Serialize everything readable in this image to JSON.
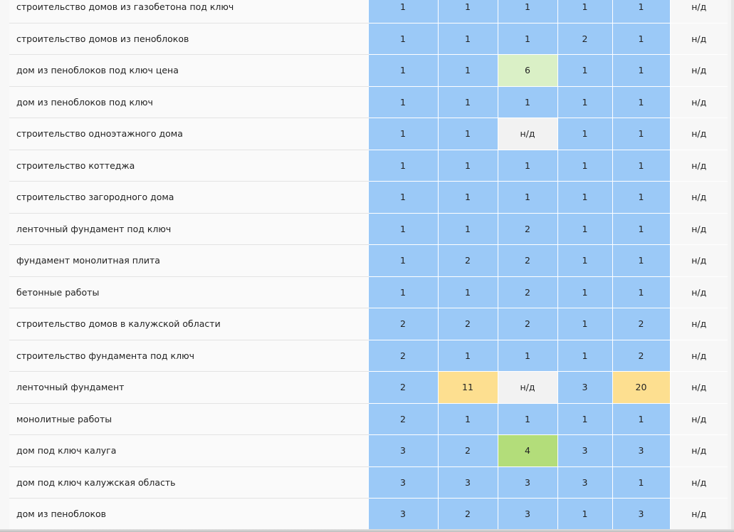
{
  "rows": [
    {
      "keyword": "строительство домов из газобетона под ключ",
      "values": [
        "1",
        "1",
        "1",
        "1",
        "1",
        "н/д"
      ],
      "colors": [
        "blue",
        "blue",
        "blue",
        "blue",
        "blue",
        "na"
      ]
    },
    {
      "keyword": "строительство домов из пеноблоков",
      "values": [
        "1",
        "1",
        "1",
        "2",
        "1",
        "н/д"
      ],
      "colors": [
        "blue",
        "blue",
        "blue",
        "blue",
        "blue",
        "na"
      ]
    },
    {
      "keyword": "дом из пеноблоков под ключ цена",
      "values": [
        "1",
        "1",
        "6",
        "1",
        "1",
        "н/д"
      ],
      "colors": [
        "blue",
        "blue",
        "lgreen",
        "blue",
        "blue",
        "na"
      ]
    },
    {
      "keyword": "дом из пеноблоков под ключ",
      "values": [
        "1",
        "1",
        "1",
        "1",
        "1",
        "н/д"
      ],
      "colors": [
        "blue",
        "blue",
        "blue",
        "blue",
        "blue",
        "na"
      ]
    },
    {
      "keyword": "строительство одноэтажного дома",
      "values": [
        "1",
        "1",
        "н/д",
        "1",
        "1",
        "н/д"
      ],
      "colors": [
        "blue",
        "blue",
        "na",
        "blue",
        "blue",
        "na"
      ]
    },
    {
      "keyword": "строительство коттеджа",
      "values": [
        "1",
        "1",
        "1",
        "1",
        "1",
        "н/д"
      ],
      "colors": [
        "blue",
        "blue",
        "blue",
        "blue",
        "blue",
        "na"
      ]
    },
    {
      "keyword": "строительство загородного дома",
      "values": [
        "1",
        "1",
        "1",
        "1",
        "1",
        "н/д"
      ],
      "colors": [
        "blue",
        "blue",
        "blue",
        "blue",
        "blue",
        "na"
      ]
    },
    {
      "keyword": "ленточный фундамент под ключ",
      "values": [
        "1",
        "1",
        "2",
        "1",
        "1",
        "н/д"
      ],
      "colors": [
        "blue",
        "blue",
        "blue",
        "blue",
        "blue",
        "na"
      ]
    },
    {
      "keyword": "фундамент монолитная плита",
      "values": [
        "1",
        "2",
        "2",
        "1",
        "1",
        "н/д"
      ],
      "colors": [
        "blue",
        "blue",
        "blue",
        "blue",
        "blue",
        "na"
      ]
    },
    {
      "keyword": "бетонные работы",
      "values": [
        "1",
        "1",
        "2",
        "1",
        "1",
        "н/д"
      ],
      "colors": [
        "blue",
        "blue",
        "blue",
        "blue",
        "blue",
        "na"
      ]
    },
    {
      "keyword": "строительство домов в калужской области",
      "values": [
        "2",
        "2",
        "2",
        "1",
        "2",
        "н/д"
      ],
      "colors": [
        "blue",
        "blue",
        "blue",
        "blue",
        "blue",
        "na"
      ]
    },
    {
      "keyword": "строительство фундамента под ключ",
      "values": [
        "2",
        "1",
        "1",
        "1",
        "2",
        "н/д"
      ],
      "colors": [
        "blue",
        "blue",
        "blue",
        "blue",
        "blue",
        "na"
      ]
    },
    {
      "keyword": "ленточный фундамент",
      "values": [
        "2",
        "11",
        "н/д",
        "3",
        "20",
        "н/д"
      ],
      "colors": [
        "blue",
        "yellow",
        "na",
        "blue",
        "yellow",
        "na"
      ]
    },
    {
      "keyword": "монолитные работы",
      "values": [
        "2",
        "1",
        "1",
        "1",
        "1",
        "н/д"
      ],
      "colors": [
        "blue",
        "blue",
        "blue",
        "blue",
        "blue",
        "na"
      ]
    },
    {
      "keyword": "дом под ключ калуга",
      "values": [
        "3",
        "2",
        "4",
        "3",
        "3",
        "н/д"
      ],
      "colors": [
        "blue",
        "blue",
        "green",
        "blue",
        "blue",
        "na"
      ]
    },
    {
      "keyword": "дом под ключ калужская область",
      "values": [
        "3",
        "3",
        "3",
        "3",
        "1",
        "н/д"
      ],
      "colors": [
        "blue",
        "blue",
        "blue",
        "blue",
        "blue",
        "na"
      ]
    },
    {
      "keyword": "дом из пеноблоков",
      "values": [
        "3",
        "2",
        "3",
        "1",
        "3",
        "н/д"
      ],
      "colors": [
        "blue",
        "blue",
        "blue",
        "blue",
        "blue",
        "na"
      ]
    }
  ],
  "palette": {
    "blue": "#9bc9f7",
    "lgreen": "#daf0c6",
    "green": "#b3dd7a",
    "yellow": "#fddf90",
    "na": "#f2f2f2"
  }
}
